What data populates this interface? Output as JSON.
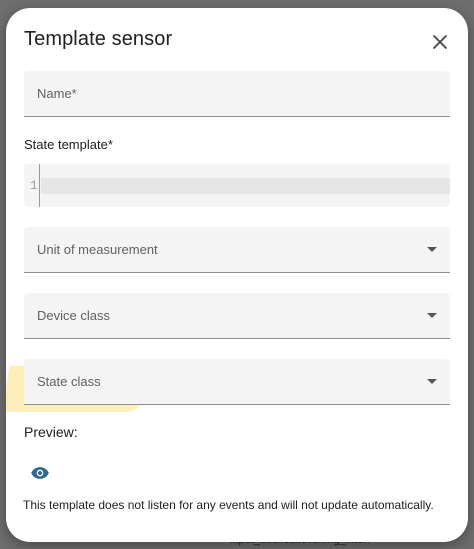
{
  "dialog": {
    "title": "Template sensor",
    "close_icon": "close-icon"
  },
  "fields": {
    "name_label": "Name*",
    "state_template_label": "State template*",
    "unit_label": "Unit of measurement",
    "device_class_label": "Device class",
    "state_class_label": "State class"
  },
  "editor": {
    "line_number": "1",
    "content": ""
  },
  "preview": {
    "heading": "Preview:",
    "icon": "eye-icon",
    "message": "This template does not listen for any events and will not update automatically."
  },
  "background": {
    "partial_text": "input_bool.cal.evening_interl"
  },
  "colors": {
    "accent_icon": "#2f6a8e",
    "highlight": "#f6dd7f"
  }
}
